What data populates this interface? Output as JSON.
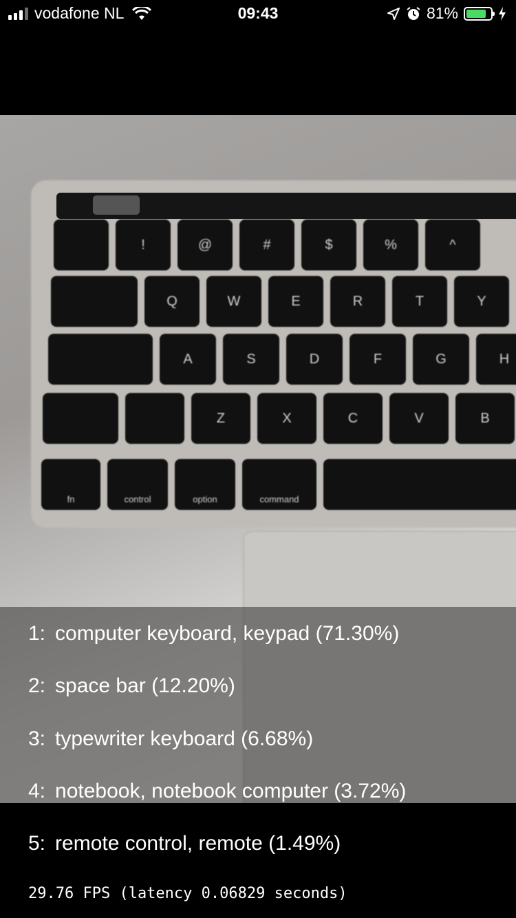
{
  "status_bar": {
    "carrier": "vodafone NL",
    "time": "09:43",
    "battery_percent": "81%",
    "battery_level": 0.81,
    "icons": [
      "signal-icon",
      "wifi-icon",
      "location-icon",
      "alarm-icon",
      "battery-icon",
      "charging-icon"
    ]
  },
  "keyboard": {
    "row_numbers": [
      "",
      "!",
      "@",
      "#",
      "$",
      "%",
      "^"
    ],
    "row_qwerty": [
      "",
      "Q",
      "W",
      "E",
      "R",
      "T",
      "Y"
    ],
    "row_asdf": [
      "",
      "A",
      "S",
      "D",
      "F",
      "G",
      "H"
    ],
    "row_zxcv": [
      "",
      "",
      "Z",
      "X",
      "C",
      "V",
      "B"
    ],
    "row_bottom": [
      "fn",
      "control",
      "option",
      "command",
      ""
    ]
  },
  "predictions": [
    {
      "index": "1:",
      "label": "computer keyboard, keypad (71.30%)"
    },
    {
      "index": "2:",
      "label": "space bar (12.20%)"
    },
    {
      "index": "3:",
      "label": "typewriter keyboard (6.68%)"
    },
    {
      "index": "4:",
      "label": "notebook, notebook computer (3.72%)"
    },
    {
      "index": "5:",
      "label": "remote control, remote (1.49%)"
    }
  ],
  "fps_text": "29.76 FPS (latency 0.06829 seconds)"
}
